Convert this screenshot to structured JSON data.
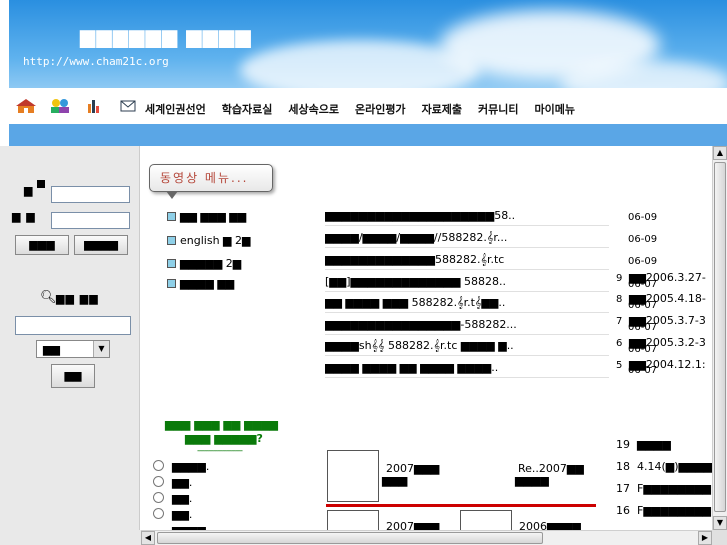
{
  "header": {
    "site_title": "▆▆▆▆▆▆ ▆▆▆▆",
    "url": "http://www.cham21c.org",
    "icons": [
      "home-icon",
      "people-icon",
      "chart-icon",
      "mail-icon"
    ],
    "menu": [
      "세계인권선언",
      "학습자료실",
      "세상속으로",
      "온라인평가",
      "자료제출",
      "커뮤니티",
      "마이메뉴"
    ]
  },
  "login": {
    "id_label": "▆",
    "pw_label": "▆ ▆",
    "buttons": [
      "▆▆▆",
      "▆▆▆▆"
    ],
    "search_label": "▆▆ ▆▆",
    "select_value": "▆▆",
    "search_button": "▆▆"
  },
  "video_menu": {
    "title": "동영상 메뉴...",
    "links": [
      "▆▆ ▆▆▆ ▆▆",
      "english ▆ 2▆",
      "▆▆▆▆▆ 2▆",
      "▆▆▆▆ ▆▆"
    ]
  },
  "video_list": [
    {
      "title": "▆▆▆▆▆▆▆▆▆▆▆▆▆▆▆▆▆▆▆▆58..",
      "date": "06-09"
    },
    {
      "title": "▆▆▆▆/▆▆▆▆/▆▆▆▆//588282.𝄞r...",
      "date": "06-09"
    },
    {
      "title": "▆▆▆▆▆▆▆▆▆▆▆▆▆588282.𝄞r.tc",
      "date": "06-09"
    },
    {
      "title": "[▆▆]▆▆▆▆▆▆▆▆▆▆▆▆▆ 58828..",
      "date": "06-07"
    },
    {
      "title": "▆▆ ▆▆▆▆ ▆▆▆ 588282.𝄞r.t𝄞▆▆..",
      "date": "06-07"
    },
    {
      "title": "▆▆▆▆▆▆▆▆▆▆▆▆▆▆▆▆-588282...",
      "date": "06-07"
    },
    {
      "title": "▆▆▆▆sh𝄞𝄞 588282.𝄞r.tc ▆▆▆▆ ▆..",
      "date": "06-07"
    },
    {
      "title": "▆▆▆▆ ▆▆▆▆ ▆▆ ▆▆▆▆ ▆▆▆▆..",
      "date": "06-07"
    }
  ],
  "right_list": [
    {
      "num": "9",
      "text": "▆▆2006.3.27-"
    },
    {
      "num": "8",
      "text": "▆▆2005.4.18-"
    },
    {
      "num": "7",
      "text": "▆▆2005.3.7-3"
    },
    {
      "num": "6",
      "text": "▆▆2005.3.2-3"
    },
    {
      "num": "5",
      "text": "▆▆2004.12.1:"
    }
  ],
  "poll": {
    "title": "▆▆▆ ▆▆▆ ▆▆ ▆▆▆▆",
    "subtitle": "▆▆▆ ▆▆▆▆▆?",
    "dash": "--------------------",
    "options": [
      "▆▆▆▆.",
      "▆▆.",
      "▆▆.",
      "▆▆.",
      "▆▆▆▆"
    ]
  },
  "gallery": {
    "item1_text1": "2007▆▆▆",
    "item1_text2": "▆▆▆",
    "item1_right": "Re..2007▆▆",
    "item1_right2": "▆▆▆▆",
    "item2_text1": "2007▆▆▆",
    "item2_text2": "2006▆▆▆▆"
  },
  "side_list": [
    {
      "num": "19",
      "text": "▆▆▆▆"
    },
    {
      "num": "18",
      "text": "4.14(▆)▆▆▆▆"
    },
    {
      "num": "17",
      "text": "F▆▆▆▆▆▆▆▆"
    },
    {
      "num": "16",
      "text": "F▆▆▆▆▆▆▆▆"
    }
  ]
}
